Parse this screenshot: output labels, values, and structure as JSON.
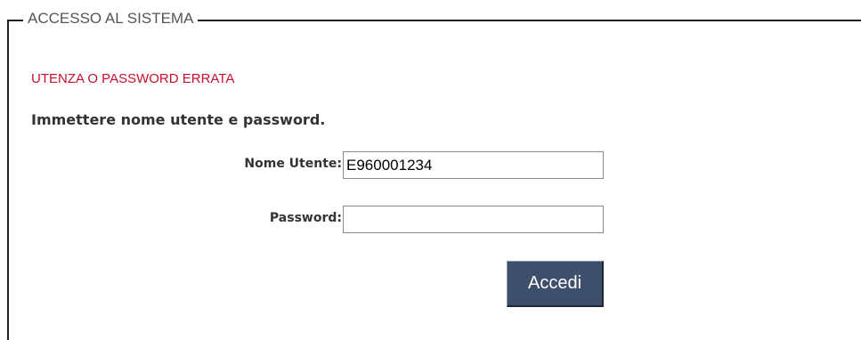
{
  "fieldset": {
    "legend": "ACCESSO AL SISTEMA"
  },
  "error_message": "UTENZA O PASSWORD ERRATA",
  "instruction": "Immettere nome utente e password.",
  "form": {
    "username": {
      "label": "Nome Utente:",
      "value": "E960001234",
      "placeholder": ""
    },
    "password": {
      "label": "Password:",
      "value": "",
      "placeholder": ""
    },
    "submit_label": "Accedi"
  },
  "colors": {
    "error": "#c8102e",
    "button_background": "#3d4f6b",
    "frame_border": "#222222",
    "legend_text": "#555555"
  }
}
